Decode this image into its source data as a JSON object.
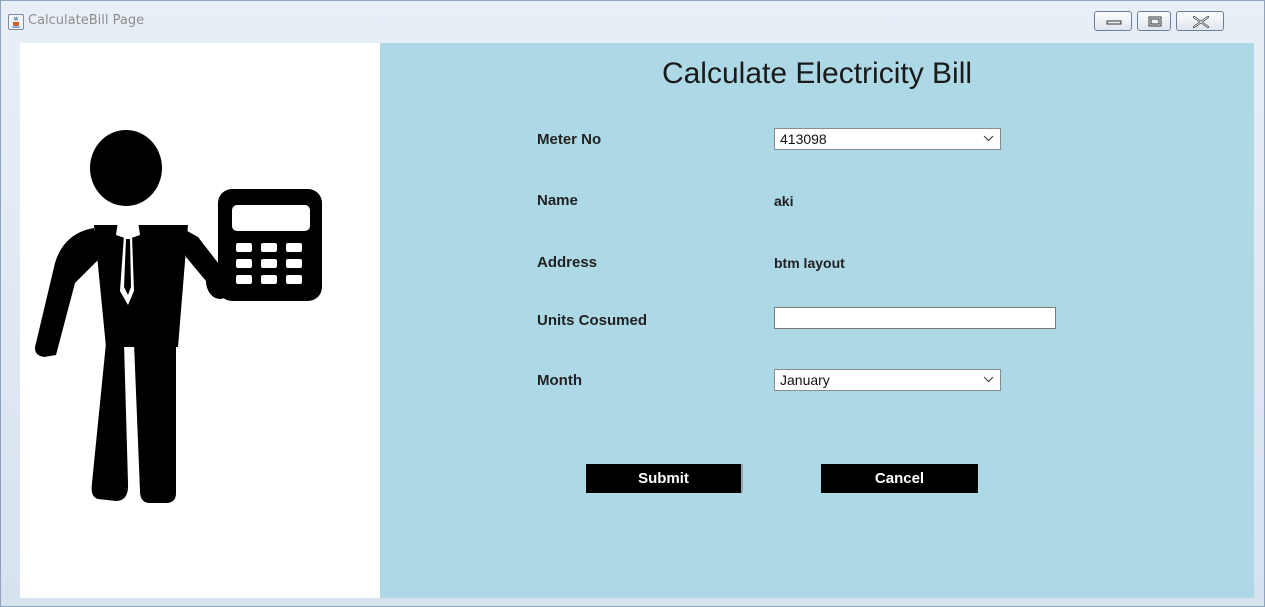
{
  "window": {
    "title": "CalculateBill Page",
    "icon": "java-cup-icon"
  },
  "form": {
    "heading": "Calculate Electricity Bill",
    "meter_no": {
      "label": "Meter No",
      "selected": "413098"
    },
    "name": {
      "label": "Name",
      "value": "aki"
    },
    "address": {
      "label": "Address",
      "value": "btm layout"
    },
    "units": {
      "label": "Units Cosumed",
      "value": ""
    },
    "month": {
      "label": "Month",
      "selected": "January"
    },
    "submit_label": "Submit",
    "cancel_label": "Cancel"
  },
  "illustration": {
    "icon": "businessman-with-calculator-icon"
  },
  "colors": {
    "form_background": "#add8e6",
    "button_background": "#000000",
    "button_text": "#ffffff"
  }
}
